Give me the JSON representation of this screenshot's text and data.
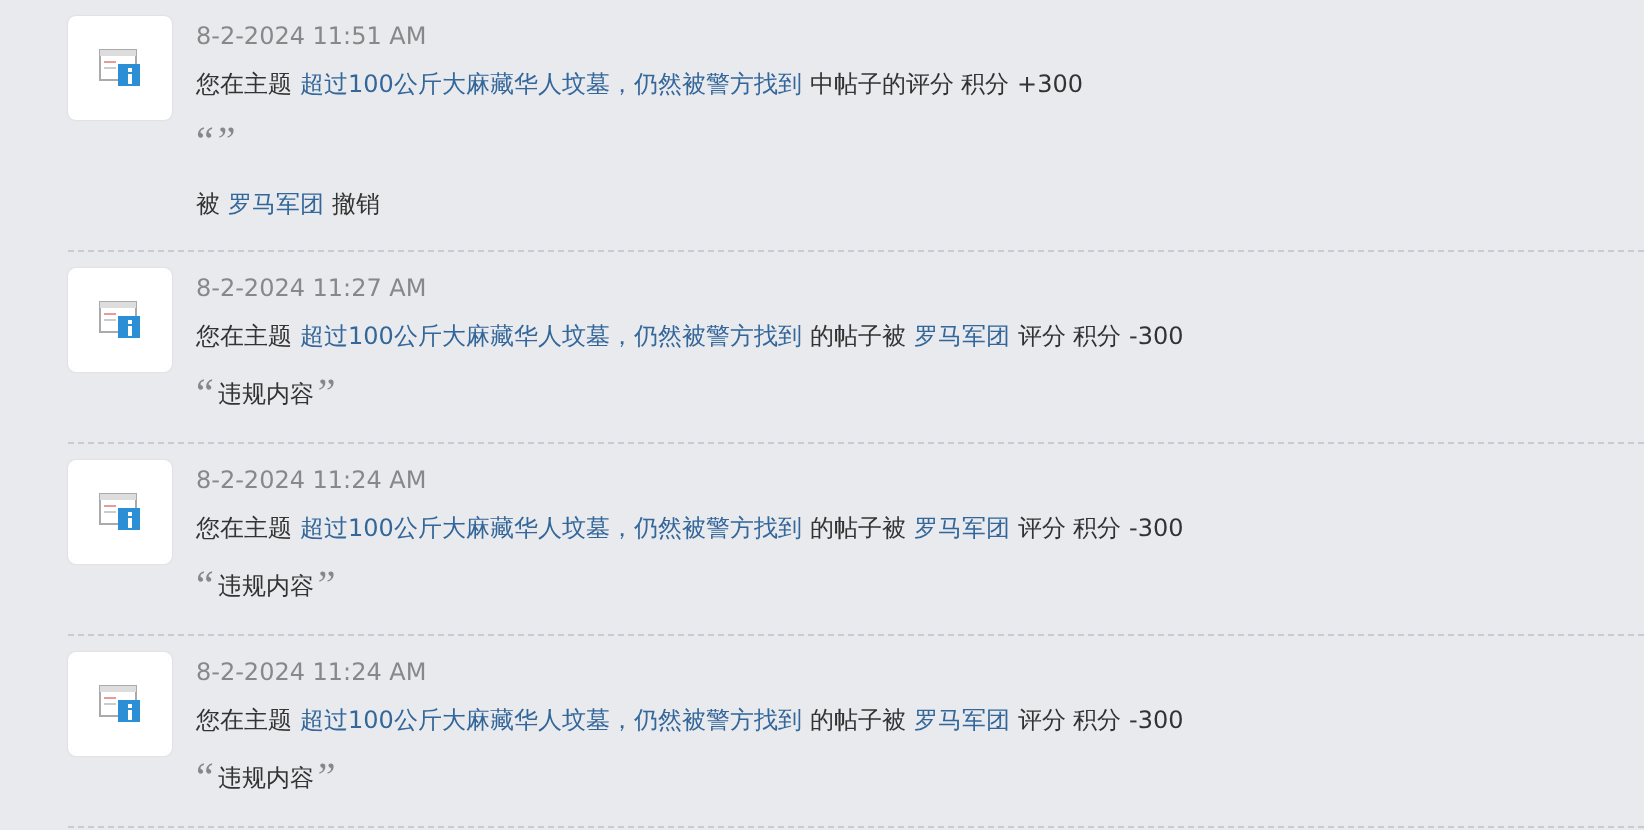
{
  "notices": [
    {
      "time": "8-2-2024 11:51 AM",
      "message": [
        {
          "kind": "plain",
          "text": "您在主题"
        },
        {
          "kind": "link",
          "text": "超过100公斤大麻藏华人坟墓，仍然被警方找到"
        },
        {
          "kind": "plain",
          "text": "中帖子的评分 积分 +300"
        }
      ],
      "quote": {
        "open": "“",
        "close": "”"
      },
      "note": [
        {
          "kind": "plain",
          "text": "被"
        },
        {
          "kind": "link",
          "text": "罗马军团"
        },
        {
          "kind": "plain",
          "text": "撤销"
        }
      ]
    },
    {
      "time": "8-2-2024 11:27 AM",
      "message": [
        {
          "kind": "plain",
          "text": "您在主题"
        },
        {
          "kind": "link",
          "text": "超过100公斤大麻藏华人坟墓，仍然被警方找到"
        },
        {
          "kind": "plain",
          "text": "的帖子被"
        },
        {
          "kind": "link",
          "text": "罗马军团"
        },
        {
          "kind": "plain",
          "text": "评分 积分 -300"
        }
      ],
      "quote": {
        "open": "“",
        "text": "违规内容",
        "close": "”"
      }
    },
    {
      "time": "8-2-2024 11:24 AM",
      "message": [
        {
          "kind": "plain",
          "text": "您在主题"
        },
        {
          "kind": "link",
          "text": "超过100公斤大麻藏华人坟墓，仍然被警方找到"
        },
        {
          "kind": "plain",
          "text": "的帖子被"
        },
        {
          "kind": "link",
          "text": "罗马军团"
        },
        {
          "kind": "plain",
          "text": "评分 积分 -300"
        }
      ],
      "quote": {
        "open": "“",
        "text": "违规内容",
        "close": "”"
      }
    },
    {
      "time": "8-2-2024 11:24 AM",
      "message": [
        {
          "kind": "plain",
          "text": "您在主题"
        },
        {
          "kind": "link",
          "text": "超过100公斤大麻藏华人坟墓，仍然被警方找到"
        },
        {
          "kind": "plain",
          "text": "的帖子被"
        },
        {
          "kind": "link",
          "text": "罗马军团"
        },
        {
          "kind": "plain",
          "text": "评分 积分 -300"
        }
      ],
      "quote": {
        "open": "“",
        "text": "违规内容",
        "close": "”"
      }
    }
  ]
}
